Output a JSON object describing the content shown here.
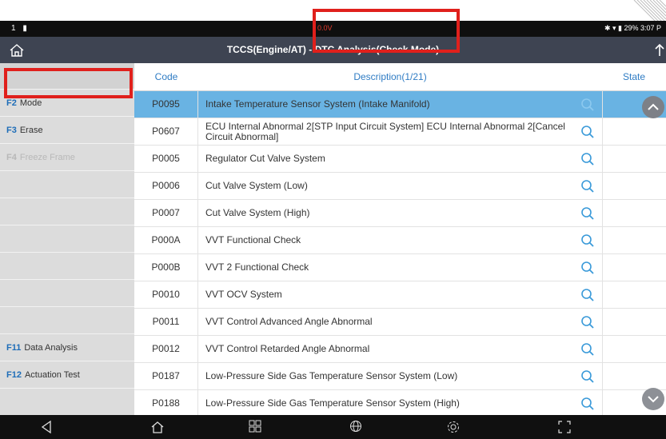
{
  "status_bar": {
    "left": "1 ▮",
    "center": "0.0V",
    "right": "✱ ▾ ▮ 29% 3:07 P"
  },
  "header": {
    "title": "TCCS(Engine/AT) - DTC Analysis(Check Mode)"
  },
  "columns": {
    "code": "Code",
    "description": "Description(1/21)",
    "state": "State"
  },
  "sidebar": {
    "items": [
      {
        "key": "",
        "label": ""
      },
      {
        "key": "F2",
        "label": "Mode"
      },
      {
        "key": "F3",
        "label": "Erase"
      },
      {
        "key": "F4",
        "label": "Freeze Frame"
      },
      {
        "key": "",
        "label": ""
      },
      {
        "key": "",
        "label": ""
      },
      {
        "key": "",
        "label": ""
      },
      {
        "key": "",
        "label": ""
      },
      {
        "key": "",
        "label": ""
      },
      {
        "key": "",
        "label": ""
      },
      {
        "key": "F11",
        "label": "Data Analysis"
      },
      {
        "key": "F12",
        "label": "Actuation Test"
      },
      {
        "key": "",
        "label": ""
      }
    ]
  },
  "rows": [
    {
      "code": "P0095",
      "description": "Intake Temperature Sensor System (Intake Manifold)"
    },
    {
      "code": "P0607",
      "description": "ECU Internal Abnormal 2[STP Input Circuit System] ECU Internal Abnormal 2[Cancel Circuit Abnormal]"
    },
    {
      "code": "P0005",
      "description": "Regulator Cut Valve System"
    },
    {
      "code": "P0006",
      "description": "Cut Valve System (Low)"
    },
    {
      "code": "P0007",
      "description": "Cut Valve System (High)"
    },
    {
      "code": "P000A",
      "description": "VVT Functional Check"
    },
    {
      "code": "P000B",
      "description": "VVT 2 Functional Check"
    },
    {
      "code": "P0010",
      "description": "VVT OCV System"
    },
    {
      "code": "P0011",
      "description": "VVT Control Advanced Angle Abnormal"
    },
    {
      "code": "P0012",
      "description": "VVT Control Retarded Angle Abnormal"
    },
    {
      "code": "P0187",
      "description": "Low-Pressure Side Gas Temperature Sensor System (Low)"
    },
    {
      "code": "P0188",
      "description": "Low-Pressure Side Gas Temperature Sensor System (High)"
    }
  ],
  "colors": {
    "accent": "#2f7cc4",
    "selected_row": "#69b3e3",
    "highlight_box": "#e0201c",
    "title_bar": "#3e4452"
  },
  "icons": [
    "home-icon",
    "upload-icon",
    "search-icon",
    "scroll-up-icon",
    "scroll-down-icon",
    "back-nav-icon",
    "home-nav-icon",
    "apps-icon",
    "globe-icon",
    "settings-icon",
    "screenshot-icon"
  ]
}
